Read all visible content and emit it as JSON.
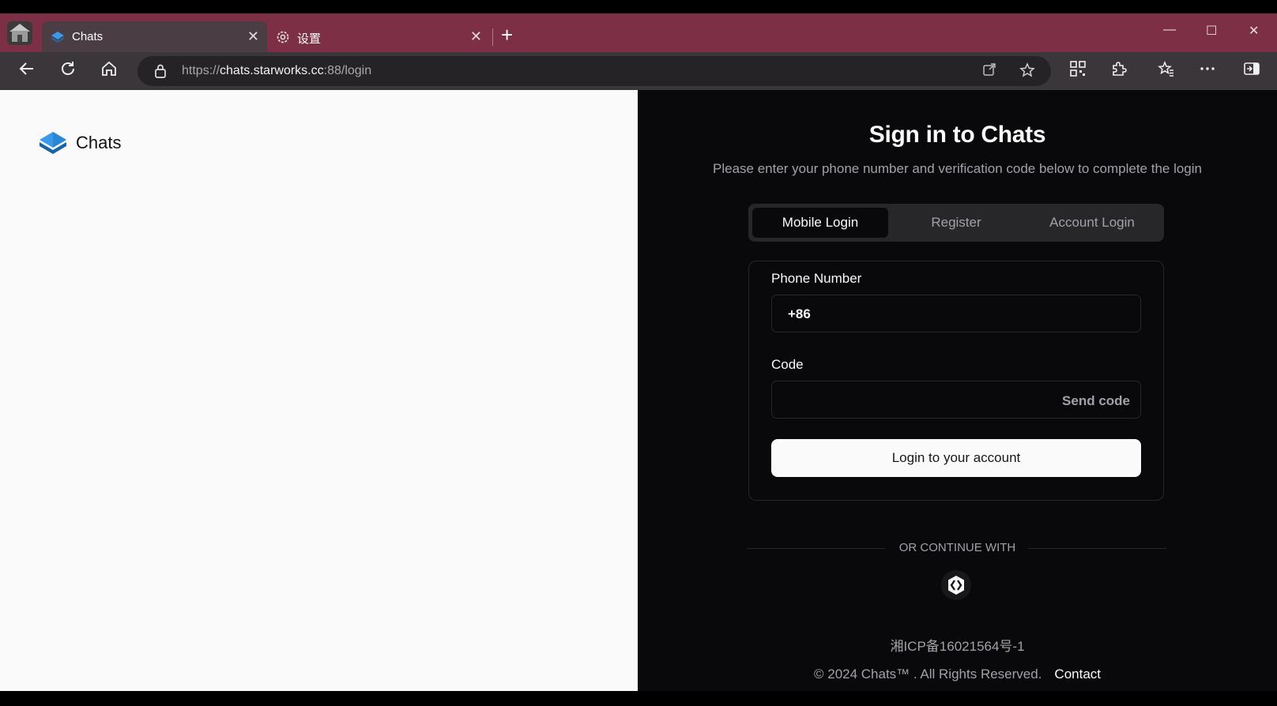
{
  "browser": {
    "tabs": [
      {
        "title": "Chats",
        "active": true
      },
      {
        "title": "设置",
        "active": false
      }
    ],
    "tab_close_glyph": "✕",
    "new_tab_glyph": "+",
    "window_controls": {
      "minimize": "—",
      "maximize": "☐",
      "close": "✕"
    },
    "url": {
      "prefix": "https://",
      "host": "chats.starworks.cc",
      "suffix": ":88/login"
    },
    "accent": "#7c2f45"
  },
  "left": {
    "brand_name": "Chats",
    "brand_color": "#1e7fd0"
  },
  "login": {
    "title": "Sign in to Chats",
    "subtitle": "Please enter your phone number and verification code below to complete the login",
    "tabs": [
      "Mobile Login",
      "Register",
      "Account Login"
    ],
    "active_tab": "Mobile Login",
    "phone_label": "Phone Number",
    "phone_value": "+86",
    "code_label": "Code",
    "code_value": "",
    "send_code": "Send code",
    "submit": "Login to your account",
    "divider": "OR CONTINUE WITH",
    "oauth_icon": "keycloak-icon",
    "icp": "湘ICP备16021564号-1",
    "copyright": "© 2024 Chats™ . All Rights Reserved.",
    "contact": "Contact"
  }
}
